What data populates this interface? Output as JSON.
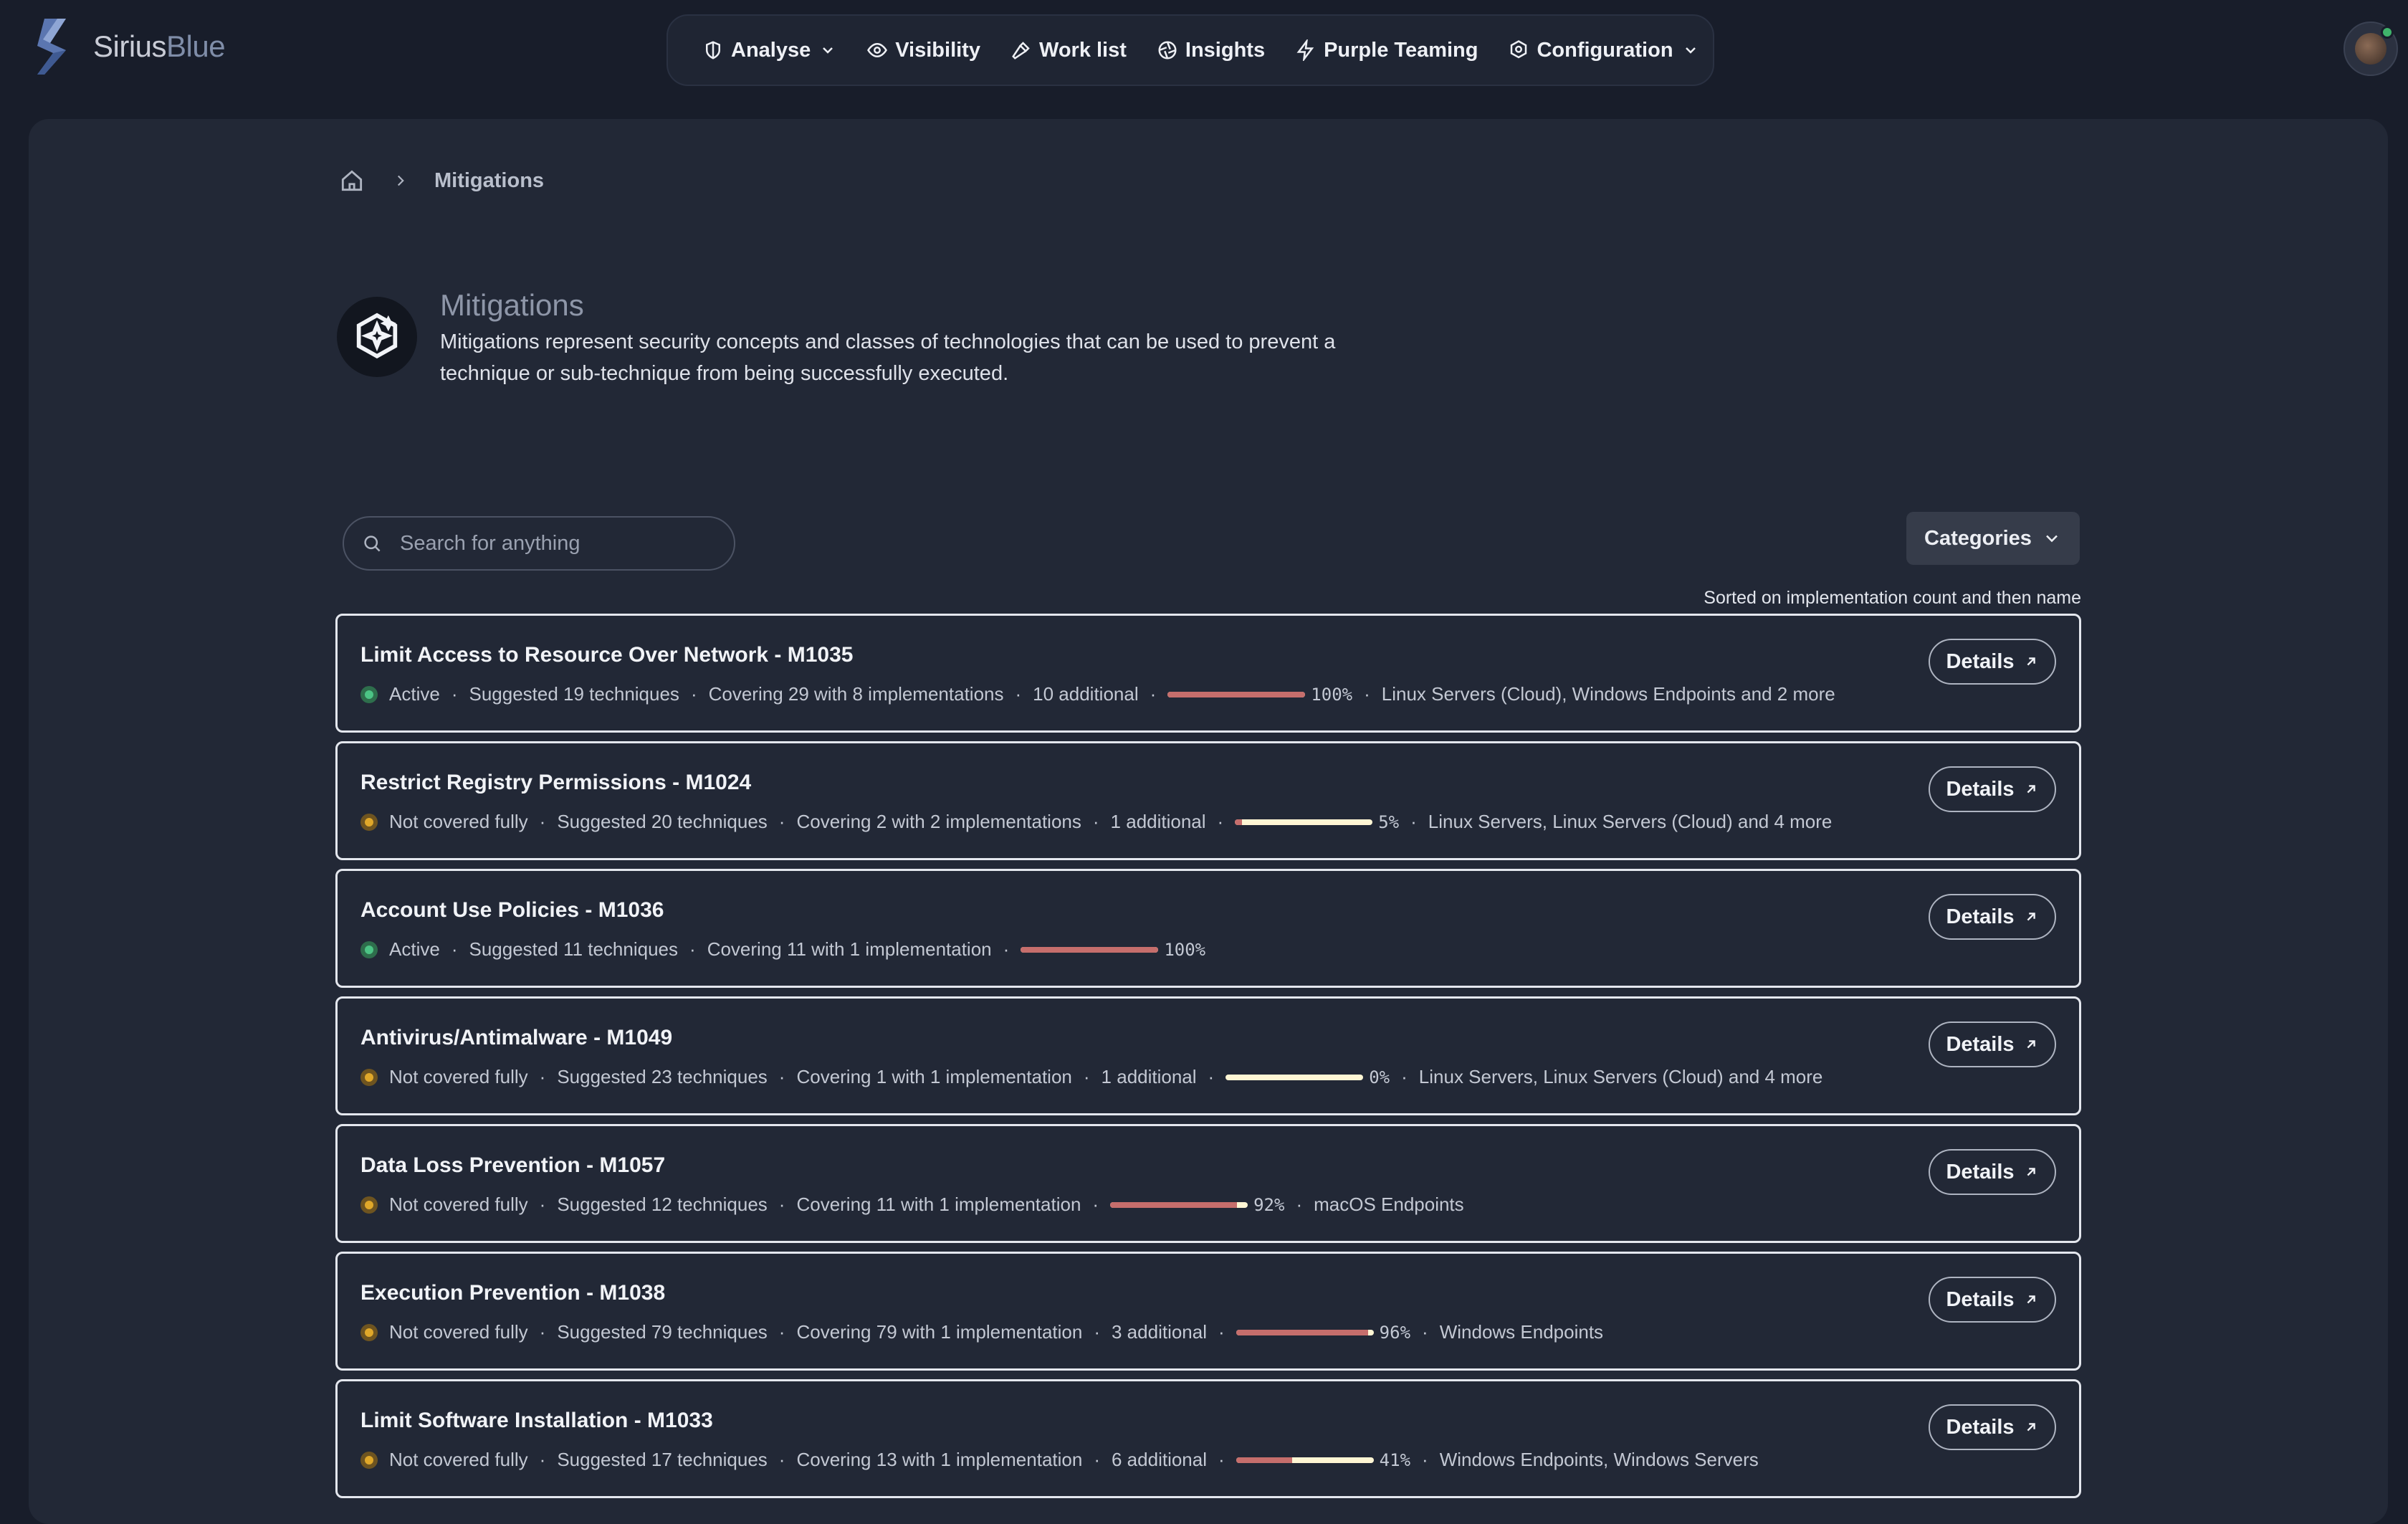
{
  "app": {
    "logo_part1": "Sirius",
    "logo_part2": "Blue"
  },
  "nav": {
    "items": [
      {
        "label": "Analyse",
        "icon": "shield-icon",
        "dropdown": true
      },
      {
        "label": "Visibility",
        "icon": "eye-icon"
      },
      {
        "label": "Work list",
        "icon": "hammer-icon"
      },
      {
        "label": "Insights",
        "icon": "aperture-icon"
      },
      {
        "label": "Purple Teaming",
        "icon": "lightning-icon"
      },
      {
        "label": "Configuration",
        "icon": "gear-icon",
        "dropdown": true
      }
    ]
  },
  "breadcrumb": {
    "current": "Mitigations"
  },
  "header": {
    "title": "Mitigations",
    "description": "Mitigations represent security concepts and classes of technologies that can be used to prevent a technique or sub-technique from being successfully executed."
  },
  "search": {
    "placeholder": "Search for anything",
    "value": ""
  },
  "filters": {
    "categories_label": "Categories"
  },
  "sort_note": "Sorted on implementation count and then name",
  "colors": {
    "active": "#4cc485",
    "partial": "#e0a82a",
    "bar_fill": "#c66e6c",
    "bar_track": "#fff6d4"
  },
  "details_label": "Details",
  "mitigations": [
    {
      "title": "Limit Access to Resource Over Network - M1035",
      "status": "Active",
      "status_color": "green",
      "suggested": "Suggested 19 techniques",
      "covering": "Covering 29 with 8 implementations",
      "additional": "10 additional",
      "progress": 1.0,
      "pct": "100%",
      "platforms": "Linux Servers (Cloud), Windows Endpoints and 2 more"
    },
    {
      "title": "Restrict Registry Permissions - M1024",
      "status": "Not covered fully",
      "status_color": "yellow",
      "suggested": "Suggested 20 techniques",
      "covering": "Covering 2 with 2 implementations",
      "additional": "1 additional",
      "progress": 0.05,
      "pct": "5%",
      "platforms": "Linux Servers, Linux Servers (Cloud) and 4 more"
    },
    {
      "title": "Account Use Policies - M1036",
      "status": "Active",
      "status_color": "green",
      "suggested": "Suggested 11 techniques",
      "covering": "Covering 11 with 1 implementation",
      "additional": "",
      "progress": 1.0,
      "pct": "100%",
      "platforms": ""
    },
    {
      "title": "Antivirus/Antimalware - M1049",
      "status": "Not covered fully",
      "status_color": "yellow",
      "suggested": "Suggested 23 techniques",
      "covering": "Covering 1 with 1 implementation",
      "additional": "1 additional",
      "progress": 0.0,
      "pct": "0%",
      "platforms": "Linux Servers, Linux Servers (Cloud) and 4 more"
    },
    {
      "title": "Data Loss Prevention - M1057",
      "status": "Not covered fully",
      "status_color": "yellow",
      "suggested": "Suggested 12 techniques",
      "covering": "Covering 11 with 1 implementation",
      "additional": "",
      "progress": 0.92,
      "pct": "92%",
      "platforms": "macOS Endpoints"
    },
    {
      "title": "Execution Prevention - M1038",
      "status": "Not covered fully",
      "status_color": "yellow",
      "suggested": "Suggested 79 techniques",
      "covering": "Covering 79 with 1 implementation",
      "additional": "3 additional",
      "progress": 0.96,
      "pct": "96%",
      "platforms": "Windows Endpoints"
    },
    {
      "title": "Limit Software Installation - M1033",
      "status": "Not covered fully",
      "status_color": "yellow",
      "suggested": "Suggested 17 techniques",
      "covering": "Covering 13 with 1 implementation",
      "additional": "6 additional",
      "progress": 0.41,
      "pct": "41%",
      "platforms": "Windows Endpoints, Windows Servers"
    }
  ]
}
